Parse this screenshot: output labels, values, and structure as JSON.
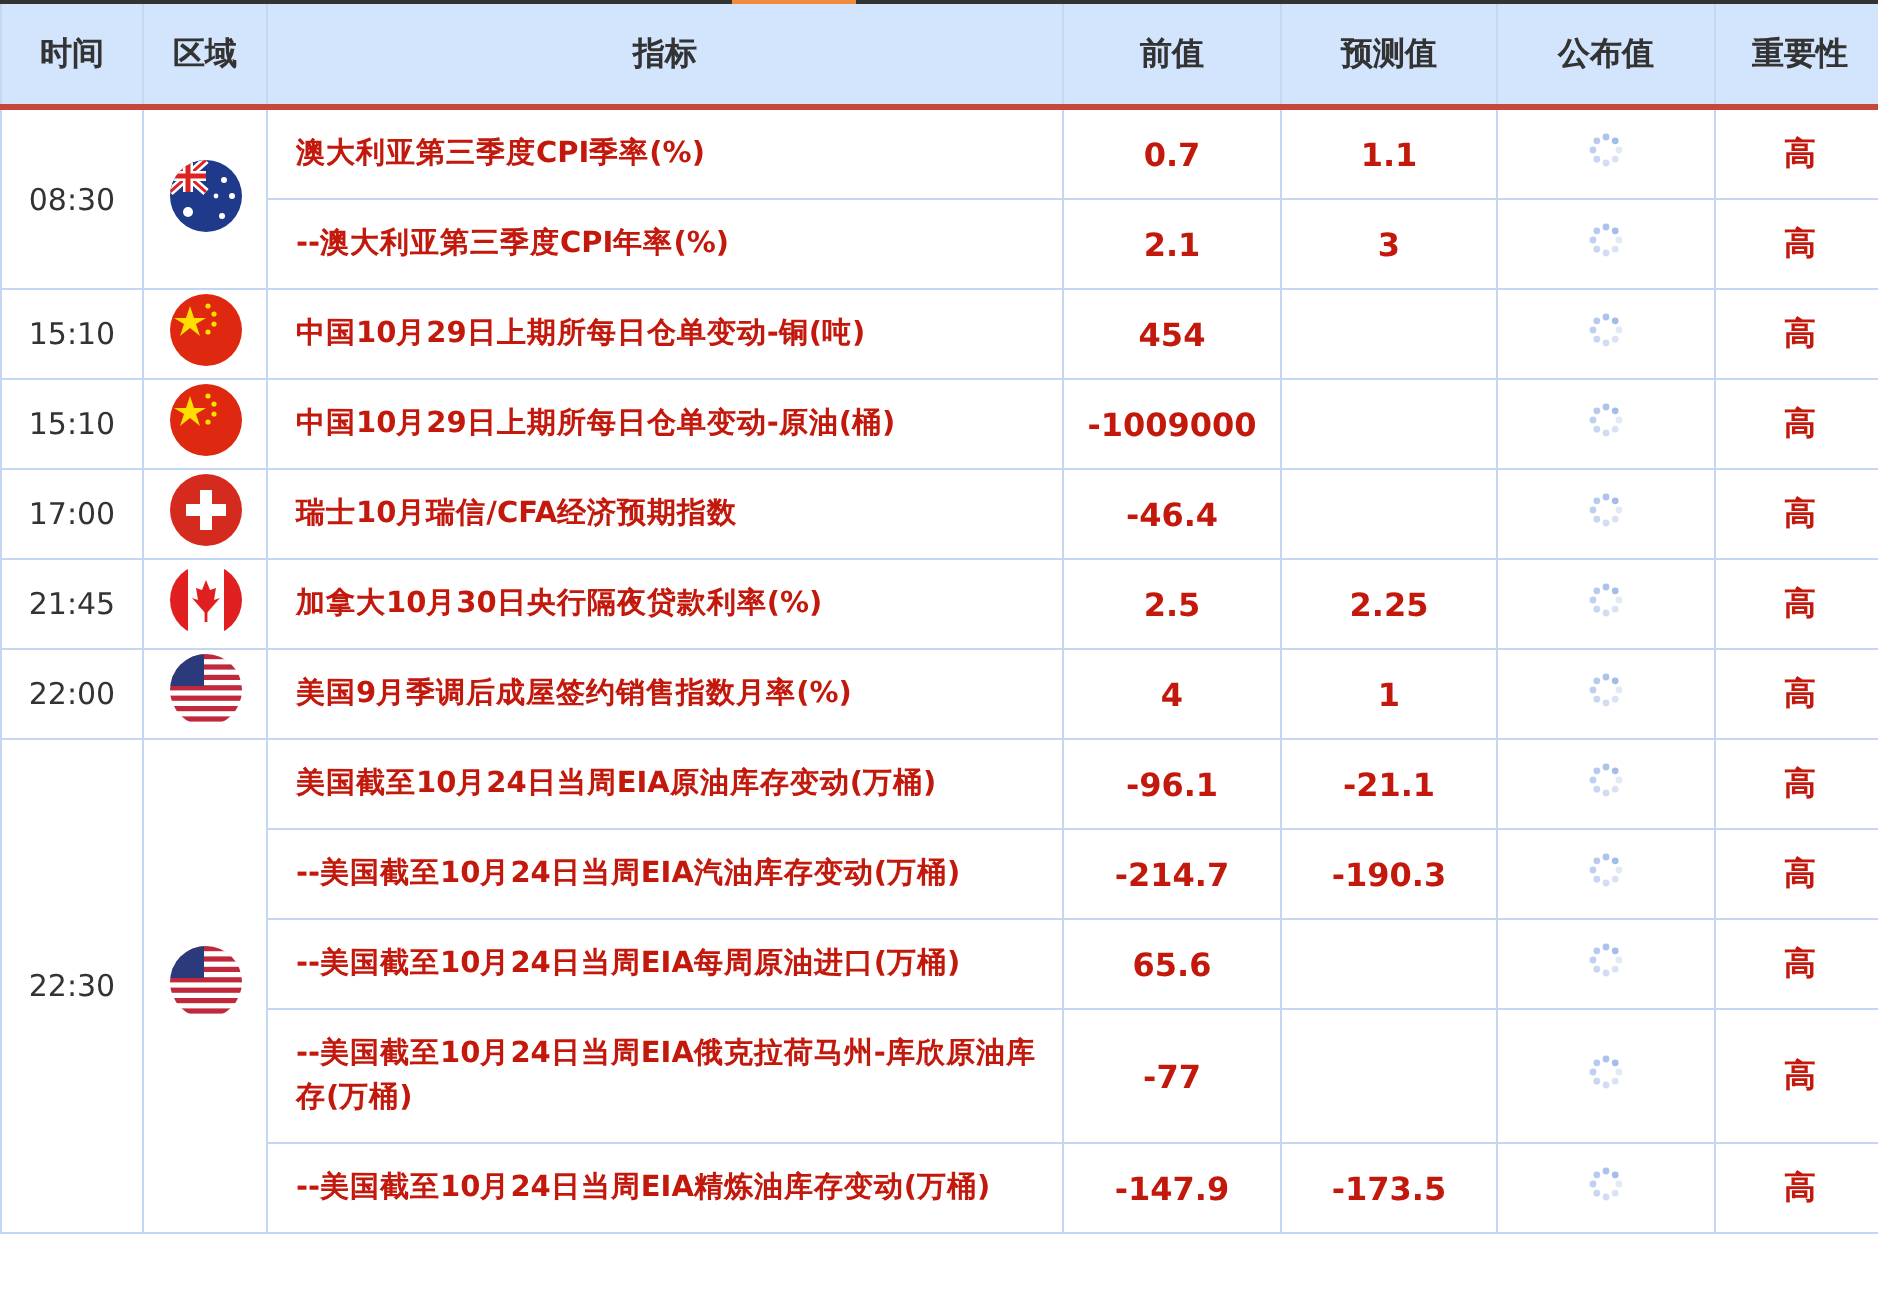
{
  "columns": [
    "时间",
    "区域",
    "指标",
    "前值",
    "预测值",
    "公布值",
    "重要性"
  ],
  "groups": [
    {
      "time": "08:30",
      "kind": "au",
      "events": [
        {
          "name": "澳大利亚第三季度CPI季率(%)",
          "previous": "0.7",
          "forecast": "1.1",
          "importance": "高"
        },
        {
          "name": "--澳大利亚第三季度CPI年率(%)",
          "previous": "2.1",
          "forecast": "3",
          "importance": "高"
        }
      ]
    },
    {
      "time": "15:10",
      "kind": "cn",
      "events": [
        {
          "name": "中国10月29日上期所每日仓单变动-铜(吨)",
          "previous": "454",
          "importance": "高"
        }
      ]
    },
    {
      "time": "15:10",
      "kind": "cn",
      "events": [
        {
          "name": "中国10月29日上期所每日仓单变动-原油(桶)",
          "previous": "-1009000",
          "importance": "高"
        }
      ]
    },
    {
      "time": "17:00",
      "kind": "ch",
      "events": [
        {
          "name": "瑞士10月瑞信/CFA经济预期指数",
          "previous": "-46.4",
          "importance": "高"
        }
      ]
    },
    {
      "time": "21:45",
      "kind": "ca",
      "events": [
        {
          "name": "加拿大10月30日央行隔夜贷款利率(%)",
          "previous": "2.5",
          "forecast": "2.25",
          "importance": "高"
        }
      ]
    },
    {
      "time": "22:00",
      "kind": "us",
      "events": [
        {
          "name": "美国9月季调后成屋签约销售指数月率(%)",
          "previous": "4",
          "forecast": "1",
          "importance": "高"
        }
      ]
    },
    {
      "time": "22:30",
      "kind": "us",
      "events": [
        {
          "name": "美国截至10月24日当周EIA原油库存变动(万桶)",
          "previous": "-96.1",
          "forecast": "-21.1",
          "importance": "高"
        },
        {
          "name": "--美国截至10月24日当周EIA汽油库存变动(万桶)",
          "previous": "-214.7",
          "forecast": "-190.3",
          "importance": "高"
        },
        {
          "name": "--美国截至10月24日当周EIA每周原油进口(万桶)",
          "previous": "65.6",
          "importance": "高"
        },
        {
          "name": "--美国截至10月24日当周EIA俄克拉荷马州-库欣原油库存(万桶)",
          "previous": "-77",
          "importance": "高"
        },
        {
          "name": "--美国截至10月24日当周EIA精炼油库存变动(万桶)",
          "previous": "-147.9",
          "forecast": "-173.5",
          "importance": "高"
        }
      ]
    }
  ]
}
